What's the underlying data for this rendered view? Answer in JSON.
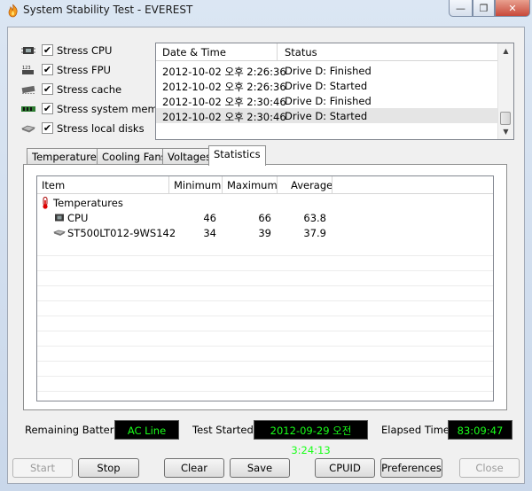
{
  "window": {
    "title": "System Stability Test - EVEREST"
  },
  "stress_options": [
    {
      "label": "Stress CPU",
      "checked": true,
      "icon": "cpu-chip-icon"
    },
    {
      "label": "Stress FPU",
      "checked": true,
      "icon": "fpu-icon"
    },
    {
      "label": "Stress cache",
      "checked": true,
      "icon": "cache-chip-icon"
    },
    {
      "label": "Stress system memory",
      "checked": true,
      "icon": "memory-module-icon"
    },
    {
      "label": "Stress local disks",
      "checked": true,
      "icon": "hard-disk-icon"
    }
  ],
  "log": {
    "headers": {
      "datetime": "Date & Time",
      "status": "Status"
    },
    "rows": [
      {
        "datetime": "2012-10-02 오후 2:26:36",
        "status": "Drive D: Finished"
      },
      {
        "datetime": "2012-10-02 오후 2:26:36",
        "status": "Drive D: Started"
      },
      {
        "datetime": "2012-10-02 오후 2:30:46",
        "status": "Drive D: Finished"
      },
      {
        "datetime": "2012-10-02 오후 2:30:46",
        "status": "Drive D: Started"
      }
    ]
  },
  "tabs": [
    "Temperatures",
    "Cooling Fans",
    "Voltages",
    "Statistics"
  ],
  "active_tab": "Statistics",
  "stats": {
    "headers": {
      "item": "Item",
      "minimum": "Minimum",
      "maximum": "Maximum",
      "average": "Average"
    },
    "group": "Temperatures",
    "rows": [
      {
        "item": "CPU",
        "minimum": "46",
        "maximum": "66",
        "average": "63.8"
      },
      {
        "item": "ST500LT012-9WS142",
        "minimum": "34",
        "maximum": "39",
        "average": "37.9"
      }
    ]
  },
  "status": {
    "battery_label": "Remaining Battery:",
    "battery_value": "AC Line",
    "test_started_label": "Test Started:",
    "test_started_value": "2012-09-29 오전 3:24:13",
    "elapsed_label": "Elapsed Time:",
    "elapsed_value": "83:09:47"
  },
  "buttons": {
    "start": "Start",
    "stop": "Stop",
    "clear": "Clear",
    "save": "Save",
    "cpuid": "CPUID",
    "preferences": "Preferences",
    "close": "Close"
  },
  "colors": {
    "lcd_background": "#000000",
    "lcd_text": "#19ff19"
  }
}
